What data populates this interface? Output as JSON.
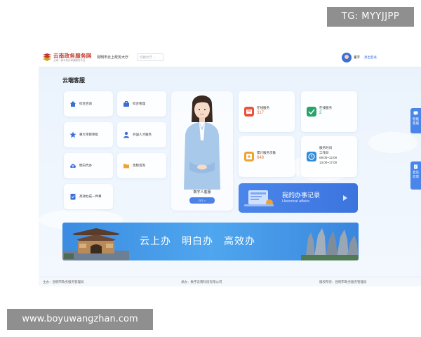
{
  "watermarks": {
    "top": "TG: MYYJJPP",
    "bottom": "www.boyuwangzhan.com"
  },
  "header": {
    "brand_name": "云南政务服务网",
    "brand_sub": "云南一部手机办事通服务平台",
    "hall_name": "昆明市云上政务大厅",
    "hall_switch": "切换大厅 ⌄",
    "user_name": "董宇",
    "logout": "退出登录"
  },
  "section_title": "云端客服",
  "services": [
    {
      "label": "综合咨询",
      "icon": "home-icon"
    },
    {
      "label": "综合管理",
      "icon": "briefcase-icon"
    },
    {
      "label": "重大项目审批",
      "icon": "star-icon"
    },
    {
      "label": "外国人才服务",
      "icon": "person-icon"
    },
    {
      "label": "明白代办",
      "icon": "cloud-upload-icon"
    },
    {
      "label": "高频咨询",
      "icon": "folder-icon"
    },
    {
      "label": "高效办成一件事",
      "icon": "checklist-icon"
    }
  ],
  "avatar": {
    "label": "数字人客服",
    "button": "GO >"
  },
  "stats": [
    {
      "label": "在线服务",
      "value": "317",
      "icon": "service-icon",
      "color": "#e8543b"
    },
    {
      "label": "在线服务",
      "value": "2",
      "icon": "online-icon",
      "color": "#2aa26a"
    },
    {
      "label": "累计服务次数",
      "value": "648",
      "icon": "count-icon",
      "color": "#f0a22e"
    },
    {
      "label": "服务时间",
      "value_lines": [
        "工作日",
        "09:00~12:00",
        "13:00~17:00"
      ],
      "icon": "clock-icon",
      "color": "#2e8ad8"
    }
  ],
  "records": {
    "title": "我的办事记录",
    "subtitle": "Historical affairs"
  },
  "banner": {
    "text": "云上办　明白办　高效办"
  },
  "side_tabs": [
    {
      "label": "智能客服"
    },
    {
      "label": "意见反馈"
    }
  ],
  "footer": {
    "host": "主办：昆明市政务服务管理局",
    "support": "承办：数字云南科技有限公司",
    "copyright": "版权所有：昆明市政务服务管理局"
  },
  "colors": {
    "accent": "#4a86ea",
    "brand_red": "#c0392b"
  }
}
